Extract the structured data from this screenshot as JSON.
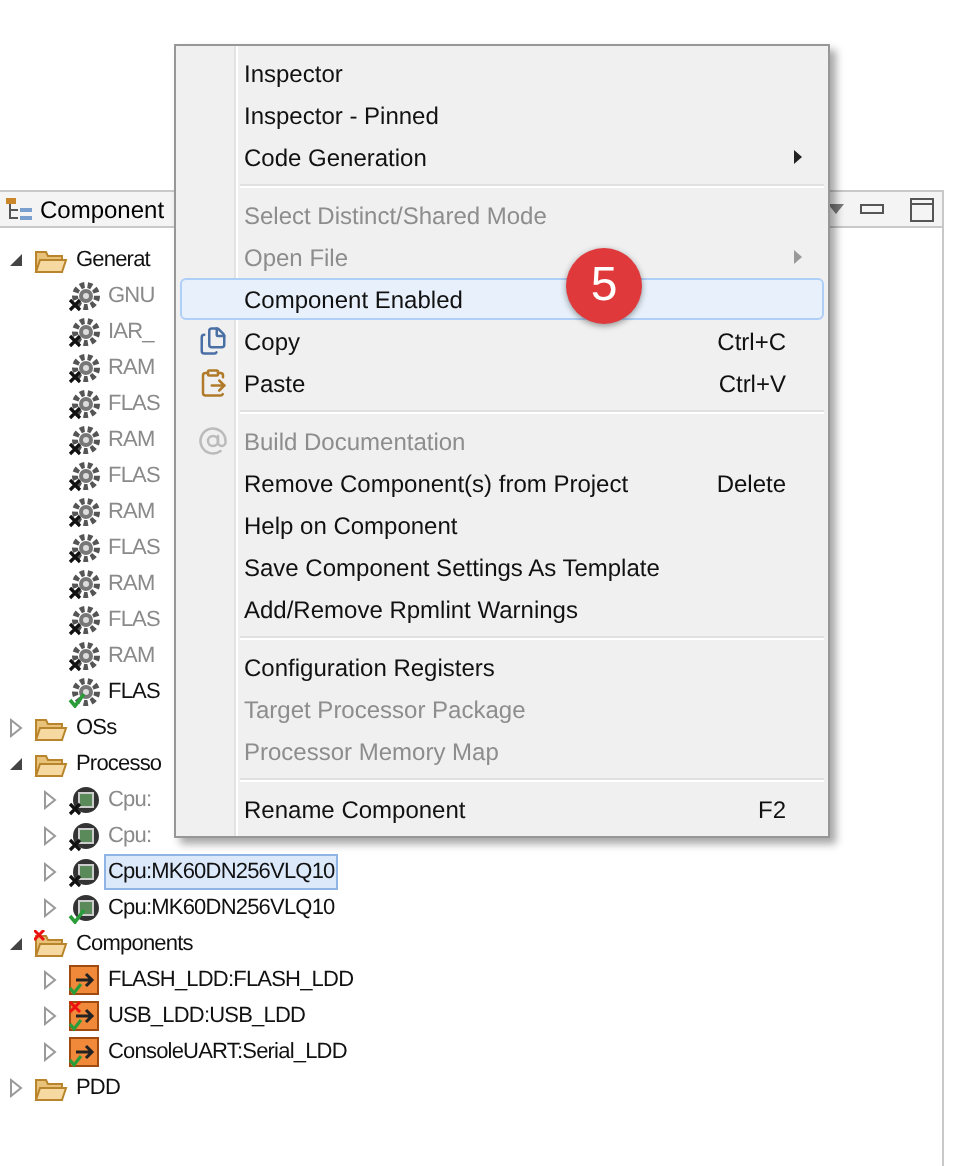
{
  "panel": {
    "title": "Component"
  },
  "tree": [
    {
      "label": "Generat",
      "kind": "folder",
      "expanded": true,
      "error": false,
      "selected": false,
      "children": [
        {
          "label": "GNU",
          "kind": "gear",
          "enabled": false,
          "selected": false
        },
        {
          "label": "IAR_",
          "kind": "gear",
          "enabled": false,
          "selected": false
        },
        {
          "label": "RAM",
          "kind": "gear",
          "enabled": false,
          "selected": false
        },
        {
          "label": "FLAS",
          "kind": "gear",
          "enabled": false,
          "selected": false
        },
        {
          "label": "RAM",
          "kind": "gear",
          "enabled": false,
          "selected": false
        },
        {
          "label": "FLAS",
          "kind": "gear",
          "enabled": false,
          "selected": false
        },
        {
          "label": "RAM",
          "kind": "gear",
          "enabled": false,
          "selected": false
        },
        {
          "label": "FLAS",
          "kind": "gear",
          "enabled": false,
          "selected": false
        },
        {
          "label": "RAM",
          "kind": "gear",
          "enabled": false,
          "selected": false
        },
        {
          "label": "FLAS",
          "kind": "gear",
          "enabled": false,
          "selected": false
        },
        {
          "label": "RAM",
          "kind": "gear",
          "enabled": false,
          "selected": false
        },
        {
          "label": "FLAS",
          "kind": "gear",
          "enabled": true,
          "selected": false
        }
      ]
    },
    {
      "label": "OSs",
      "kind": "folder",
      "expanded": false,
      "error": false,
      "selected": false
    },
    {
      "label": "Processo",
      "kind": "folder",
      "expanded": true,
      "error": false,
      "selected": false,
      "children": [
        {
          "label": "Cpu:",
          "kind": "cpu",
          "enabled": false,
          "expanded": false,
          "selected": false
        },
        {
          "label": "Cpu:",
          "kind": "cpu",
          "enabled": false,
          "expanded": false,
          "selected": false
        },
        {
          "label": "Cpu:MK60DN256VLQ10",
          "kind": "cpu",
          "enabled": false,
          "expanded": false,
          "selected": true
        },
        {
          "label": "Cpu:MK60DN256VLQ10",
          "kind": "cpu",
          "enabled": true,
          "expanded": false,
          "selected": false
        }
      ]
    },
    {
      "label": "Components",
      "kind": "folder",
      "expanded": true,
      "error": true,
      "selected": false,
      "children": [
        {
          "label": "FLASH_LDD:FLASH_LDD",
          "kind": "component",
          "expanded": false,
          "error": false,
          "selected": false
        },
        {
          "label": "USB_LDD:USB_LDD",
          "kind": "component",
          "expanded": false,
          "error": true,
          "selected": false
        },
        {
          "label": "ConsoleUART:Serial_LDD",
          "kind": "component",
          "expanded": false,
          "error": false,
          "selected": false
        }
      ]
    },
    {
      "label": "PDD",
      "kind": "folder",
      "expanded": false,
      "error": false,
      "selected": false
    }
  ],
  "context_menu": [
    {
      "kind": "item",
      "label": "Inspector",
      "disabled": false,
      "highlighted": false
    },
    {
      "kind": "item",
      "label": "Inspector - Pinned",
      "disabled": false,
      "highlighted": false
    },
    {
      "kind": "item",
      "label": "Code Generation",
      "disabled": false,
      "highlighted": false,
      "submenu": true
    },
    {
      "kind": "separator"
    },
    {
      "kind": "item",
      "label": "Select Distinct/Shared Mode",
      "disabled": true,
      "highlighted": false
    },
    {
      "kind": "item",
      "label": "Open File",
      "disabled": true,
      "highlighted": false,
      "submenu": true
    },
    {
      "kind": "item",
      "label": "Component Enabled",
      "disabled": false,
      "highlighted": true
    },
    {
      "kind": "item",
      "label": "Copy",
      "disabled": false,
      "highlighted": false,
      "shortcut": "Ctrl+C"
    },
    {
      "kind": "item",
      "label": "Paste",
      "disabled": false,
      "highlighted": false,
      "shortcut": "Ctrl+V"
    },
    {
      "kind": "separator"
    },
    {
      "kind": "item",
      "label": "Build Documentation",
      "disabled": true,
      "highlighted": false
    },
    {
      "kind": "item",
      "label": "Remove Component(s) from Project",
      "disabled": false,
      "highlighted": false,
      "shortcut": "Delete"
    },
    {
      "kind": "item",
      "label": "Help on Component",
      "disabled": false,
      "highlighted": false
    },
    {
      "kind": "item",
      "label": "Save Component Settings As Template",
      "disabled": false,
      "highlighted": false
    },
    {
      "kind": "item",
      "label": "Add/Remove Rpmlint Warnings",
      "disabled": false,
      "highlighted": false
    },
    {
      "kind": "separator"
    },
    {
      "kind": "item",
      "label": "Configuration Registers",
      "disabled": false,
      "highlighted": false
    },
    {
      "kind": "item",
      "label": "Target Processor Package",
      "disabled": true,
      "highlighted": false
    },
    {
      "kind": "item",
      "label": "Processor Memory Map",
      "disabled": true,
      "highlighted": false
    },
    {
      "kind": "separator"
    },
    {
      "kind": "item",
      "label": "Rename Component",
      "disabled": false,
      "highlighted": false,
      "shortcut": "F2"
    }
  ],
  "callout": "5"
}
